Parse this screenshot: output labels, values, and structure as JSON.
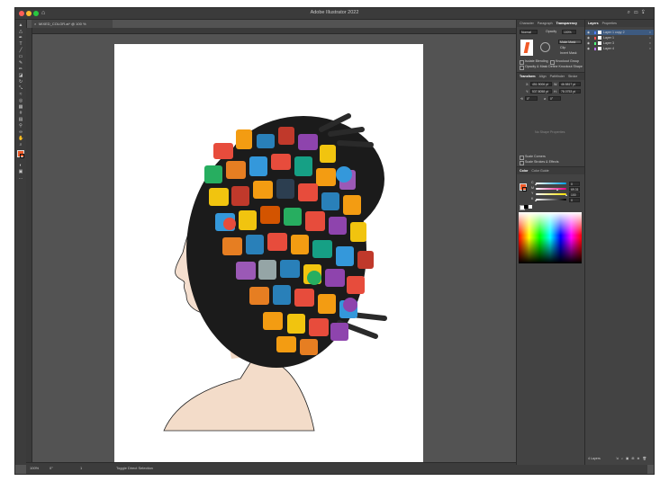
{
  "app": {
    "title": "Adobe Illustrator 2022"
  },
  "document": {
    "tab_label": "MIXED_COLOR.ai* @ 100 % (CMYK/Preview)"
  },
  "status": {
    "zoom": "100%",
    "angle": "0°",
    "artboard": "1",
    "tool": "Toggle Direct Selection"
  },
  "transparency_panel": {
    "tabs": [
      "Character",
      "Paragraph",
      "Transparency"
    ],
    "active_tab": "Transparency",
    "blend_mode": "Normal",
    "opacity_label": "Opacity",
    "opacity": "100%",
    "make_mask": "Make Mask",
    "clip": "Clip",
    "invert_mask": "Invert Mask",
    "isolate_blending": "Isolate Blending",
    "knockout_group": "Knockout Group",
    "opacity_mask_define": "Opacity & Mask Define Knockout Shape"
  },
  "transform_panel": {
    "tabs": [
      "Transform",
      "Align",
      "Pathfinder",
      "Stroke"
    ],
    "x": "451.9006 pt",
    "y": "537.8058 pt",
    "w": "46.5817 pt",
    "h": "78.0753 pt",
    "angle": "0°",
    "shear": "0°",
    "no_shape_props": "No Shape Properties",
    "scale_corners": "Scale Corners",
    "scale_strokes": "Scale Strokes & Effects"
  },
  "color_panel": {
    "tabs": [
      "Color",
      "Color Guide"
    ],
    "rows": [
      {
        "label": "C",
        "value": "0",
        "color": "#00a0e9",
        "level": 0
      },
      {
        "label": "M",
        "value": "69.31",
        "color": "#e4007f",
        "level": 69.31
      },
      {
        "label": "Y",
        "value": "100",
        "color": "#ffe100",
        "level": 100
      },
      {
        "label": "K",
        "value": "0",
        "color": "#000000",
        "level": 0
      }
    ]
  },
  "layers_panel": {
    "tabs": [
      "Layers",
      "Properties"
    ],
    "rows": [
      {
        "name": "Layer 1 copy 2",
        "color": "#4f7cff",
        "selected": true
      },
      {
        "name": "Layer 1",
        "color": "#ff4f4f",
        "selected": false
      },
      {
        "name": "Layer 3",
        "color": "#4fff7c",
        "selected": false
      },
      {
        "name": "Layer 4",
        "color": "#c070ff",
        "selected": false
      }
    ],
    "count_label": "4 Layers"
  },
  "colors": {
    "window_bg": "#535353",
    "panel_bg": "#434343",
    "selection": "#3d5a80",
    "fill_swatch": "#f05a28"
  }
}
